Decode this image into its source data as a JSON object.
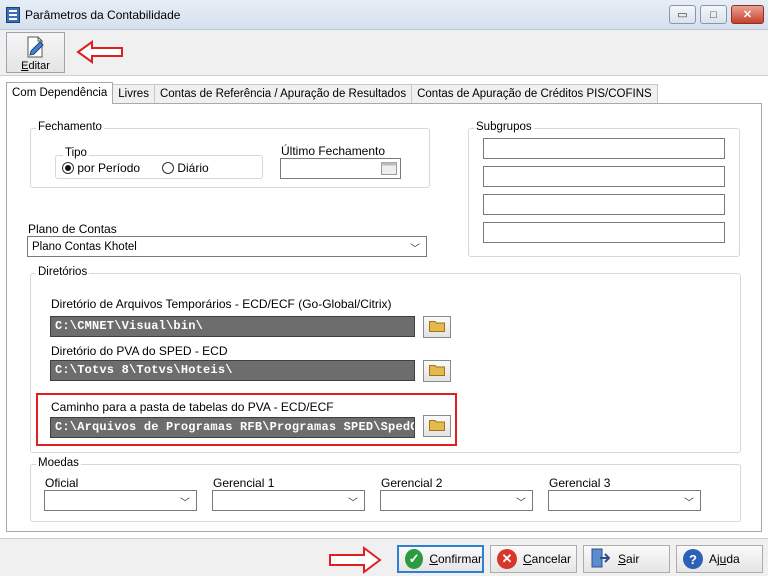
{
  "window": {
    "title": "Parâmetros da Contabilidade",
    "minimize": "▭",
    "maximize": "□",
    "close": "✕"
  },
  "toolbar": {
    "edit_label": "Editar",
    "edit_key": "E",
    "edit_rest": "ditar"
  },
  "tabs": [
    {
      "label": "Com Dependência",
      "active": true
    },
    {
      "label": "Livres",
      "active": false
    },
    {
      "label": "Contas de Referência / Apuração de Resultados",
      "active": false
    },
    {
      "label": "Contas de Apuração de Créditos PIS/COFINS",
      "active": false
    }
  ],
  "fechamento": {
    "legend": "Fechamento",
    "tipo_legend": "Tipo",
    "options": [
      {
        "label": "por Período",
        "selected": true
      },
      {
        "label": "Diário",
        "selected": false
      }
    ],
    "ultimo_label": "Último Fechamento",
    "ultimo_value": ""
  },
  "subgrupos": {
    "legend": "Subgrupos",
    "fields": [
      "",
      "",
      "",
      ""
    ]
  },
  "plano": {
    "label": "Plano de Contas",
    "value": "Plano Contas Khotel"
  },
  "diretorios": {
    "legend": "Diretórios",
    "items": [
      {
        "label": "Diretório de Arquivos Temporários - ECD/ECF (Go-Global/Citrix)",
        "value": "C:\\CMNET\\Visual\\bin\\"
      },
      {
        "label": "Diretório do PVA do SPED - ECD",
        "value": "C:\\Totvs 8\\Totvs\\Hoteis\\"
      },
      {
        "label": "Caminho para a pasta de tabelas do PVA - ECD/ECF",
        "value": "C:\\Arquivos de Programas RFB\\Programas SPED\\SpedContabil"
      }
    ]
  },
  "moedas": {
    "legend": "Moedas",
    "fields": [
      {
        "label": "Oficial",
        "value": ""
      },
      {
        "label": "Gerencial 1",
        "value": ""
      },
      {
        "label": "Gerencial 2",
        "value": ""
      },
      {
        "label": "Gerencial 3",
        "value": ""
      }
    ]
  },
  "buttons": {
    "confirmar": {
      "key": "C",
      "rest": "onfirmar"
    },
    "cancelar": {
      "key": "C",
      "rest": "ancelar"
    },
    "sair": {
      "key": "S",
      "rest": "air"
    },
    "ajuda": {
      "pre": "Aj",
      "key": "u",
      "rest": "da"
    }
  },
  "colors": {
    "highlight": "#e02020",
    "confirm_icon": "#2e9a3f",
    "cancel_icon": "#d8362b",
    "help_icon": "#2b62b8",
    "folder": "#e7b84a"
  },
  "icons": {
    "app": "ledger-icon",
    "edit": "edit-document-icon",
    "folder": "folder-icon",
    "confirm": "check-circle-icon",
    "cancel": "x-circle-icon",
    "exit": "exit-door-icon",
    "help": "question-circle-icon",
    "annotation": "red-arrow-icon",
    "calendar": "calendar-icon"
  }
}
